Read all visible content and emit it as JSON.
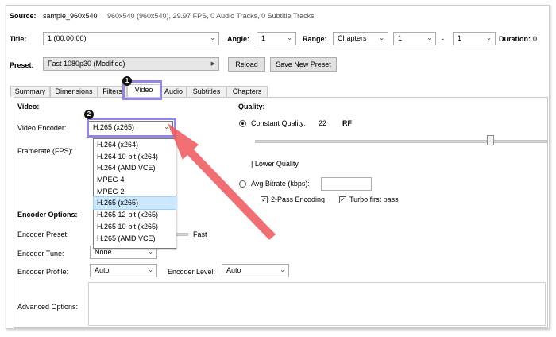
{
  "source": {
    "label": "Source:",
    "name": "sample_960x540",
    "info": "960x540 (960x540), 29.97 FPS, 0 Audio Tracks, 0 Subtitle Tracks"
  },
  "title_row": {
    "title_label": "Title:",
    "title_value": "1 (00:00:00)",
    "angle_label": "Angle:",
    "angle_value": "1",
    "range_label": "Range:",
    "range_mode": "Chapters",
    "range_start": "1",
    "range_dash": "-",
    "range_end": "1",
    "duration_label": "Duration:",
    "duration_value": "0"
  },
  "preset": {
    "label": "Preset:",
    "value": "Fast 1080p30 (Modified)",
    "reload": "Reload",
    "save_new": "Save New Preset"
  },
  "tabs": [
    "Summary",
    "Dimensions",
    "Filters",
    "Video",
    "Audio",
    "Subtitles",
    "Chapters"
  ],
  "active_tab": "Video",
  "video": {
    "section_label": "Video:",
    "encoder_label": "Video Encoder:",
    "encoder_value": "H.265 (x265)",
    "framerate_label": "Framerate (FPS):",
    "encoder_options": [
      "H.264 (x264)",
      "H.264 10-bit (x264)",
      "H.264 (AMD VCE)",
      "MPEG-4",
      "MPEG-2",
      "H.265 (x265)",
      "H.265 12-bit (x265)",
      "H.265 10-bit (x265)",
      "H.265 (AMD VCE)"
    ],
    "selected_option": "H.265 (x265)"
  },
  "quality": {
    "section_label": "Quality:",
    "constant_label": "Constant Quality:",
    "constant_value": "22",
    "rf_label": "RF",
    "slider_position_fraction": 0.81,
    "lower_quality_label": "| Lower Quality",
    "avg_bitrate_label": "Avg Bitrate (kbps):",
    "two_pass_label": "2-Pass Encoding",
    "turbo_label": "Turbo first pass",
    "two_pass_checked": true,
    "turbo_checked": true
  },
  "encoder_options_section": {
    "section_label": "Encoder Options:",
    "preset_label": "Encoder Preset:",
    "preset_speed": "Fast",
    "tune_label": "Encoder Tune:",
    "tune_value": "None",
    "profile_label": "Encoder Profile:",
    "profile_value": "Auto",
    "level_label": "Encoder Level:",
    "level_value": "Auto",
    "advanced_label": "Advanced Options:"
  },
  "annotations": {
    "badge1": "1",
    "badge2": "2",
    "callout_color": "#8f86e6",
    "arrow_color": "#ef5a5f"
  }
}
